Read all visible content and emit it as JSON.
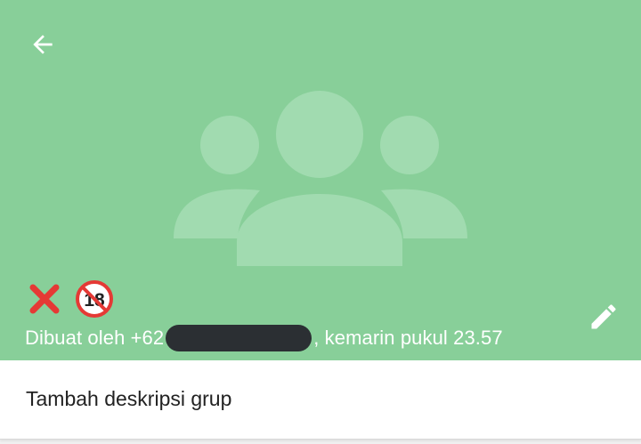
{
  "colors": {
    "header_bg": "#88cf99",
    "placeholder": "#a1dbb0",
    "redaction": "#2b2f33",
    "divider": "#d8d8d8"
  },
  "header": {
    "back_icon": "arrow-left-icon",
    "placeholder_icon": "group-icon",
    "emojis": [
      "cross-mark-icon",
      "no-one-under-eighteen-icon"
    ],
    "emoji_18_text": "18",
    "created_prefix": "Dibuat oleh +62",
    "created_suffix": ", kemarin pukul 23.57",
    "edit_icon": "pencil-icon"
  },
  "description": {
    "placeholder": "Tambah deskripsi grup"
  }
}
